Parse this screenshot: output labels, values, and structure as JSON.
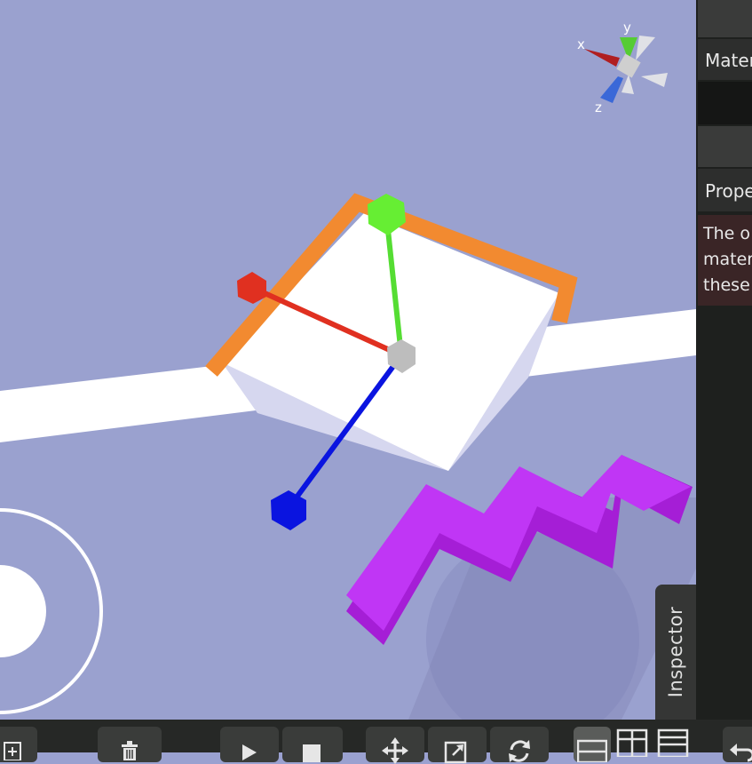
{
  "app": {
    "accent": "#f28a30",
    "background": "#9aa1cf"
  },
  "gizmo": {
    "axis_x": "x",
    "axis_y": "y",
    "axis_z": "z"
  },
  "right_panel": {
    "section_material": "Mater",
    "section_properties": "Prope",
    "warning_lines": [
      "The o",
      "mater",
      "these"
    ]
  },
  "inspector_tab": {
    "label": "Inspector"
  },
  "joystick": {
    "icon": "joystick-icon"
  },
  "toolbar": {
    "buttons": [
      {
        "name": "add-object-button",
        "icon": "add-box-icon"
      },
      {
        "name": "delete-button",
        "icon": "trash-icon"
      },
      {
        "name": "play-button",
        "icon": "play-icon"
      },
      {
        "name": "stop-button",
        "icon": "stop-icon"
      },
      {
        "name": "move-tool-button",
        "icon": "move-arrows-icon"
      },
      {
        "name": "scale-tool-button",
        "icon": "scale-icon"
      },
      {
        "name": "rotate-tool-button",
        "icon": "rotate-icon"
      },
      {
        "name": "layout-single-button",
        "icon": "layout-single-icon"
      },
      {
        "name": "layout-split-button",
        "icon": "layout-split-icon"
      },
      {
        "name": "layout-grid-button",
        "icon": "layout-grid-icon"
      },
      {
        "name": "undo-button",
        "icon": "undo-icon"
      }
    ]
  }
}
